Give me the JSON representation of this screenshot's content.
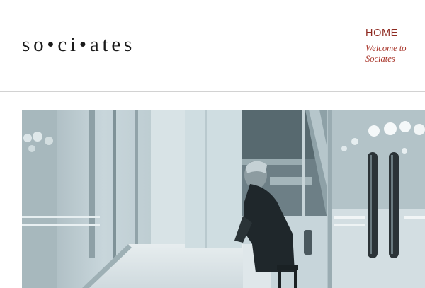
{
  "header": {
    "logo_text": "so•ci•ates",
    "nav": {
      "home_label": "HOME",
      "home_subtitle": "Welcome to\nSociates"
    }
  },
  "hero": {
    "image_alt": "Man sitting at a window counter in a bright cafe lobby with glass doors",
    "tone": "#c7d5da",
    "accent": "#8f2b22"
  }
}
